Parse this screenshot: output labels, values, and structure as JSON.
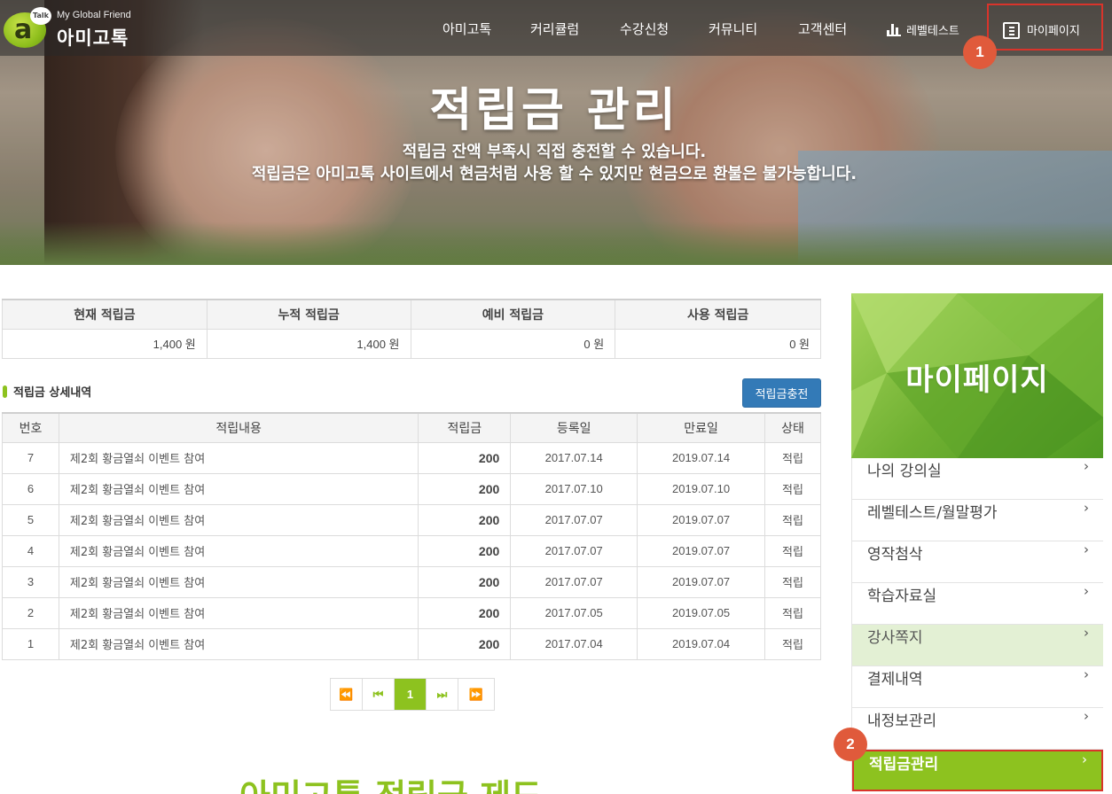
{
  "header": {
    "logo_sub": "My Global Friend",
    "logo_main": "아미고톡",
    "logo_letter": "a",
    "logo_talk": "Talk",
    "nav": [
      "아미고톡",
      "커리큘럼",
      "수강신청",
      "커뮤니티",
      "고객센터"
    ],
    "level_test": "레벨테스트",
    "mypage": "마이페이지"
  },
  "markers": [
    "1",
    "2"
  ],
  "hero": {
    "title": "적립금 관리",
    "desc1": "적립금 잔액 부족시 직접 충전할 수 있습니다.",
    "desc2": "적립금은 아미고톡 사이트에서 현금처럼 사용 할 수 있지만 현금으로 환불은 불가능합니다."
  },
  "summary": {
    "headers": [
      "현재 적립금",
      "누적 적립금",
      "예비 적립금",
      "사용 적립금"
    ],
    "values": [
      "1,400 원",
      "1,400 원",
      "0 원",
      "0 원"
    ]
  },
  "detail": {
    "title": "적립금 상세내역",
    "charge_button": "적립금충전",
    "headers": [
      "번호",
      "적립내용",
      "적립금",
      "등록일",
      "만료일",
      "상태"
    ],
    "rows": [
      [
        "7",
        "제2회 황금열쇠 이벤트 참여",
        "200",
        "2017.07.14",
        "2019.07.14",
        "적립"
      ],
      [
        "6",
        "제2회 황금열쇠 이벤트 참여",
        "200",
        "2017.07.10",
        "2019.07.10",
        "적립"
      ],
      [
        "5",
        "제2회 황금열쇠 이벤트 참여",
        "200",
        "2017.07.07",
        "2019.07.07",
        "적립"
      ],
      [
        "4",
        "제2회 황금열쇠 이벤트 참여",
        "200",
        "2017.07.07",
        "2019.07.07",
        "적립"
      ],
      [
        "3",
        "제2회 황금열쇠 이벤트 참여",
        "200",
        "2017.07.07",
        "2019.07.07",
        "적립"
      ],
      [
        "2",
        "제2회 황금열쇠 이벤트 참여",
        "200",
        "2017.07.05",
        "2019.07.05",
        "적립"
      ],
      [
        "1",
        "제2회 황금열쇠 이벤트 참여",
        "200",
        "2017.07.04",
        "2019.07.04",
        "적립"
      ]
    ]
  },
  "pagination": {
    "first": "⏪",
    "prev": "⏮",
    "current": "1",
    "next": "⏭",
    "last": "⏩"
  },
  "guide_title": "아미고톡 적립금 제도",
  "sidebar": {
    "banner_title": "마이페이지",
    "items": [
      {
        "label": "나의 강의실",
        "state": "normal"
      },
      {
        "label": "레벨테스트/월말평가",
        "state": "normal"
      },
      {
        "label": "영작첨삭",
        "state": "normal"
      },
      {
        "label": "학습자료실",
        "state": "normal"
      },
      {
        "label": "강사쪽지",
        "state": "hover"
      },
      {
        "label": "결제내역",
        "state": "normal"
      },
      {
        "label": "내정보관리",
        "state": "normal"
      },
      {
        "label": "적립금관리",
        "state": "active"
      }
    ],
    "chevron": "›"
  },
  "colors": {
    "accent": "#8dc21f",
    "button_blue": "#337ab7",
    "highlight_red": "#d9342b",
    "marker": "#e05a3b"
  }
}
